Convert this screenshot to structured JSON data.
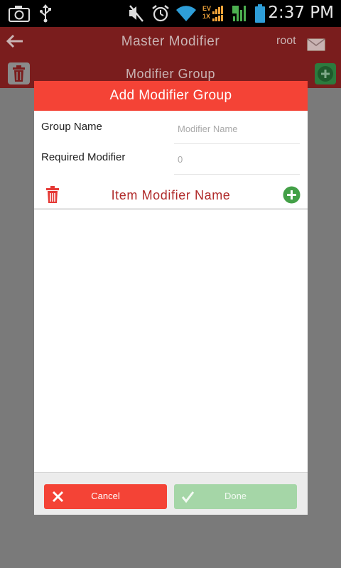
{
  "status_bar": {
    "time": "2:37 PM",
    "icons": [
      "camera-icon",
      "usb-icon",
      "mute-icon",
      "alarm-icon",
      "wifi-icon",
      "evdo-signal-icon",
      "cell-signal-icon",
      "battery-icon"
    ],
    "network_top": "EV",
    "network_bottom": "1X"
  },
  "app_bar": {
    "title": "Master Modifier",
    "user": "root",
    "subtitle": "Modifier Group",
    "icons": [
      "back-arrow-icon",
      "mail-icon",
      "trash-icon",
      "add-icon"
    ]
  },
  "dialog": {
    "title": "Add Modifier Group",
    "fields": [
      {
        "label": "Group Name",
        "placeholder": "Modifier Name",
        "value": ""
      },
      {
        "label": "Required Modifier",
        "placeholder": "0",
        "value": ""
      }
    ],
    "item_header": {
      "label": "Item Modifier Name"
    },
    "buttons": {
      "cancel": "Cancel",
      "done": "Done"
    }
  },
  "colors": {
    "accent_red": "#f44336",
    "appbar_dim": "#7a1d1d",
    "item_label": "#b02a2a",
    "green": "#43a047",
    "done_disabled": "#a5d6a7",
    "overlay": "#7a7a7a"
  }
}
